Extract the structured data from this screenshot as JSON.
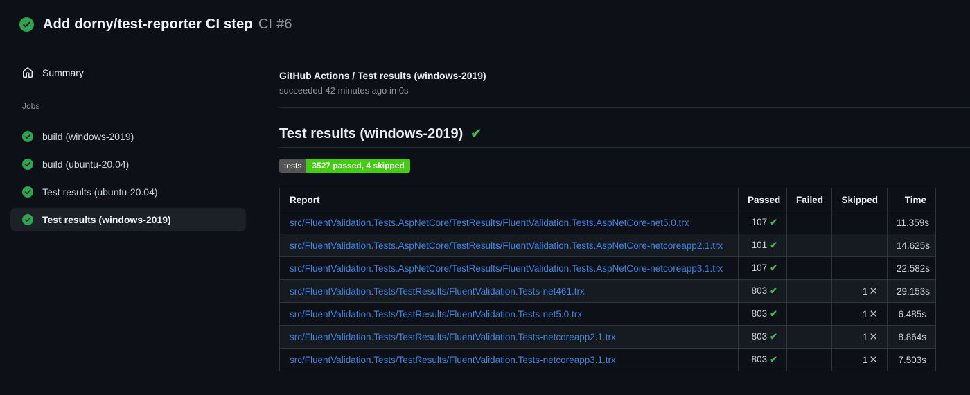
{
  "header": {
    "title": "Add dorny/test-reporter CI step",
    "run_number": "CI #6"
  },
  "sidebar": {
    "summary_label": "Summary",
    "jobs_label": "Jobs",
    "jobs": [
      {
        "label": "build (windows-2019)",
        "selected": false
      },
      {
        "label": "build (ubuntu-20.04)",
        "selected": false
      },
      {
        "label": "Test results (ubuntu-20.04)",
        "selected": false
      },
      {
        "label": "Test results (windows-2019)",
        "selected": true
      }
    ]
  },
  "main": {
    "breadcrumb": "GitHub Actions / Test results (windows-2019)",
    "status_line": "succeeded 42 minutes ago in 0s",
    "heading": "Test results (windows-2019)",
    "heading_check": "✔",
    "badge": {
      "label": "tests",
      "value": "3527 passed, 4 skipped",
      "label_bg": "#555555",
      "value_bg": "#44cc11"
    },
    "table": {
      "headers": [
        "Report",
        "Passed",
        "Failed",
        "Skipped",
        "Time"
      ],
      "rows": [
        {
          "report": "src/FluentValidation.Tests.AspNetCore/TestResults/FluentValidation.Tests.AspNetCore-net5.0.trx",
          "passed": "107",
          "failed": "",
          "skipped": "",
          "time": "11.359s"
        },
        {
          "report": "src/FluentValidation.Tests.AspNetCore/TestResults/FluentValidation.Tests.AspNetCore-netcoreapp2.1.trx",
          "passed": "101",
          "failed": "",
          "skipped": "",
          "time": "14.625s"
        },
        {
          "report": "src/FluentValidation.Tests.AspNetCore/TestResults/FluentValidation.Tests.AspNetCore-netcoreapp3.1.trx",
          "passed": "107",
          "failed": "",
          "skipped": "",
          "time": "22.582s"
        },
        {
          "report": "src/FluentValidation.Tests/TestResults/FluentValidation.Tests-net461.trx",
          "passed": "803",
          "failed": "",
          "skipped": "1",
          "time": "29.153s"
        },
        {
          "report": "src/FluentValidation.Tests/TestResults/FluentValidation.Tests-net5.0.trx",
          "passed": "803",
          "failed": "",
          "skipped": "1",
          "time": "6.485s"
        },
        {
          "report": "src/FluentValidation.Tests/TestResults/FluentValidation.Tests-netcoreapp2.1.trx",
          "passed": "803",
          "failed": "",
          "skipped": "1",
          "time": "8.864s"
        },
        {
          "report": "src/FluentValidation.Tests/TestResults/FluentValidation.Tests-netcoreapp3.1.trx",
          "passed": "803",
          "failed": "",
          "skipped": "1",
          "time": "7.503s"
        }
      ]
    }
  },
  "icons": {
    "status_success": "check-circle-fill",
    "summary": "home",
    "pass_mark": "✔",
    "skip_mark": "✕"
  },
  "colors": {
    "background": "#0d1117",
    "success_green": "#2ea44f",
    "check_green": "#3fb950",
    "link_blue": "#4083e0",
    "muted_text": "#8b949e",
    "table_border": "#30363d",
    "row_alt_bg": "#161b22",
    "selected_bg": "#1c2128"
  }
}
